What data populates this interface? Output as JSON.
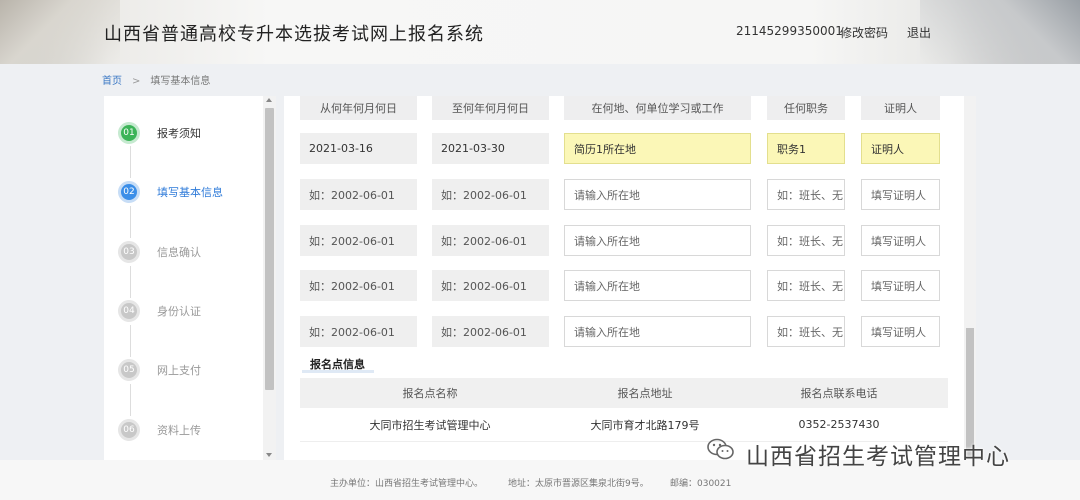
{
  "header": {
    "title": "山西省普通高校专升本选拔考试网上报名系统",
    "user_id": "21145299350001",
    "change_password": "修改密码",
    "logout": "退出"
  },
  "breadcrumb": {
    "home": "首页",
    "separator": ">",
    "current": "填写基本信息"
  },
  "steps": [
    {
      "num": "01",
      "label": "报考须知",
      "state": "done"
    },
    {
      "num": "02",
      "label": "填写基本信息",
      "state": "active"
    },
    {
      "num": "03",
      "label": "信息确认",
      "state": "pending"
    },
    {
      "num": "04",
      "label": "身份认证",
      "state": "pending"
    },
    {
      "num": "05",
      "label": "网上支付",
      "state": "pending"
    },
    {
      "num": "06",
      "label": "资料上传",
      "state": "pending"
    }
  ],
  "resume": {
    "headers": [
      "从何年何月何日",
      "至何年何月何日",
      "在何地、何单位学习或工作",
      "任何职务",
      "证明人"
    ],
    "filled_row": {
      "from": "2021-03-16",
      "to": "2021-03-30",
      "place": "简历1所在地",
      "position": "职务1",
      "witness": "证明人"
    },
    "placeholders": {
      "from": "如：2002-06-01",
      "to": "如：2002-06-01",
      "place": "请输入所在地",
      "position": "如：班长、无",
      "witness": "填写证明人"
    }
  },
  "registration_site": {
    "section_title": "报名点信息",
    "headers": [
      "报名点名称",
      "报名点地址",
      "报名点联系电话"
    ],
    "name": "大同市招生考试管理中心",
    "address": "大同市育才北路179号",
    "phone": "0352-2537430"
  },
  "footer": {
    "host": "主办单位：山西省招生考试管理中心。",
    "address": "地址：太原市晋源区集泉北街9号。",
    "postcode": "邮编：030021"
  },
  "watermark": {
    "text": "山西省招生考试管理中心",
    "icon": "wechat-icon"
  }
}
